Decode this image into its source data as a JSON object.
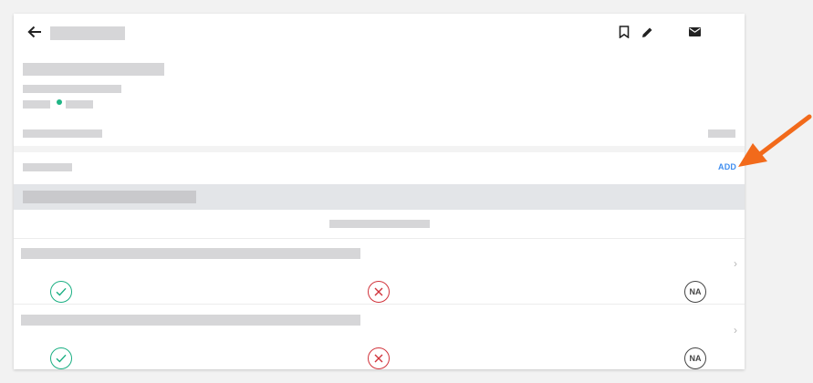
{
  "header": {
    "back_icon": "arrow-left-icon",
    "actions": [
      {
        "icon": "bookmark-icon"
      },
      {
        "icon": "pencil-icon"
      },
      {
        "icon": "mail-icon"
      }
    ]
  },
  "status": {
    "dot_color": "#1fb585"
  },
  "section": {
    "add_label": "ADD",
    "add_color": "#3f8ef0"
  },
  "items": [
    {
      "pass_icon": "check-circle-icon",
      "fail_icon": "x-circle-icon",
      "na_label": "NA"
    },
    {
      "pass_icon": "check-circle-icon",
      "fail_icon": "x-circle-icon",
      "na_label": "NA"
    }
  ],
  "colors": {
    "pass": "#1aaf82",
    "fail": "#d1333b",
    "na": "#444444",
    "annotation_arrow": "#f26a1b"
  }
}
